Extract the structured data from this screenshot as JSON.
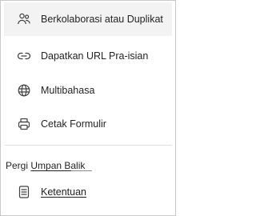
{
  "menu": {
    "items": [
      {
        "label": "Berkolaborasi atau Duplikat",
        "icon": "people-icon"
      },
      {
        "label": "Dapatkan URL Pra-isian",
        "icon": "link-icon"
      },
      {
        "label": "Multibahasa",
        "icon": "globe-icon"
      },
      {
        "label": "Cetak Formulir",
        "icon": "printer-icon"
      }
    ],
    "feedback": {
      "prefix": "Pergi",
      "link": "Umpan Balik"
    },
    "terms": {
      "label": "Ketentuan",
      "icon": "document-icon"
    }
  },
  "colors": {
    "text": "#242424",
    "hover_bg": "#f3f3f3",
    "border": "#c8c8c8"
  }
}
